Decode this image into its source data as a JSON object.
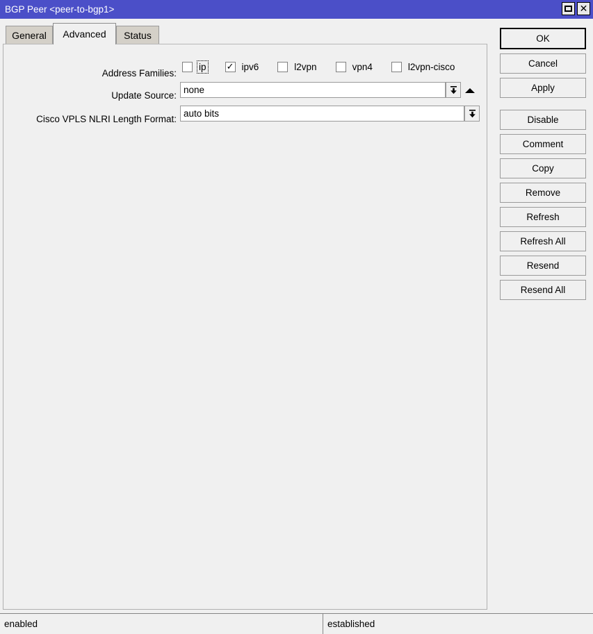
{
  "window": {
    "title": "BGP Peer <peer-to-bgp1>",
    "maximize_icon": "maximize-icon",
    "close_icon": "close-icon",
    "close_glyph": "✕"
  },
  "colors": {
    "titlebar": "#4b4fc8",
    "titlebar_text": "#ffffff",
    "window_bg": "#f0f0f0",
    "tab_inactive": "#d4d0c8",
    "tab_active": "#f0f0f0",
    "field_bg": "#ffffff",
    "border": "#9a9a9a"
  },
  "tabs": [
    {
      "label": "General",
      "active": false
    },
    {
      "label": "Advanced",
      "active": true
    },
    {
      "label": "Status",
      "active": false
    }
  ],
  "form": {
    "address_families": {
      "label": "Address Families:",
      "options": [
        {
          "label": "ip",
          "checked": false,
          "focused": true
        },
        {
          "label": "ipv6",
          "checked": true,
          "focused": false
        },
        {
          "label": "l2vpn",
          "checked": false,
          "focused": false
        },
        {
          "label": "vpn4",
          "checked": false,
          "focused": false
        },
        {
          "label": "l2vpn-cisco",
          "checked": false,
          "focused": false
        }
      ]
    },
    "update_source": {
      "label": "Update Source:",
      "value": "none",
      "dropdown_icon": "dropdown-arrow-icon",
      "collapse_icon": "collapse-up-arrow-icon"
    },
    "cisco_vpls_nlri": {
      "label": "Cisco VPLS NLRI Length Format:",
      "value": "auto bits",
      "dropdown_icon": "dropdown-arrow-icon"
    }
  },
  "buttons": [
    {
      "label": "OK",
      "default": true
    },
    {
      "label": "Cancel",
      "default": false
    },
    {
      "label": "Apply",
      "default": false
    },
    {
      "label": "Disable",
      "default": false
    },
    {
      "label": "Comment",
      "default": false
    },
    {
      "label": "Copy",
      "default": false
    },
    {
      "label": "Remove",
      "default": false
    },
    {
      "label": "Refresh",
      "default": false
    },
    {
      "label": "Refresh All",
      "default": false
    },
    {
      "label": "Resend",
      "default": false
    },
    {
      "label": "Resend All",
      "default": false
    }
  ],
  "statusbar": {
    "left": "enabled",
    "right": "established"
  }
}
